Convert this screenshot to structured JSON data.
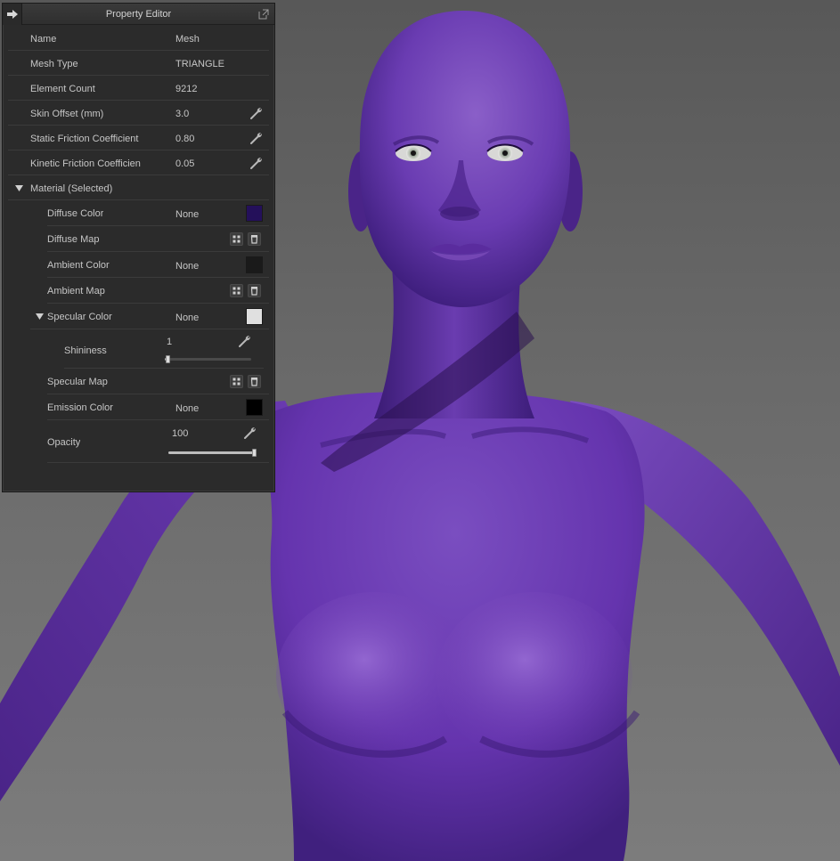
{
  "panel": {
    "title": "Property Editor",
    "rows": [
      {
        "label": "Name",
        "value": "Mesh"
      },
      {
        "label": "Mesh Type",
        "value": "TRIANGLE"
      },
      {
        "label": "Element Count",
        "value": "9212"
      },
      {
        "label": "Skin Offset (mm)",
        "value": "3.0"
      },
      {
        "label": "Static Friction Coefficient",
        "value": "0.80"
      },
      {
        "label": "Kinetic Friction Coefficient",
        "value": "0.05"
      }
    ],
    "material": {
      "header": "Material (Selected)",
      "diffuse_color": {
        "label": "Diffuse Color",
        "value": "None",
        "swatch": "#24105a"
      },
      "diffuse_map": {
        "label": "Diffuse Map"
      },
      "ambient_color": {
        "label": "Ambient Color",
        "value": "None",
        "swatch": "#1a1a1a"
      },
      "ambient_map": {
        "label": "Ambient Map"
      },
      "specular_color": {
        "label": "Specular Color",
        "value": "None",
        "swatch": "#e0e0e0"
      },
      "shininess": {
        "label": "Shininess",
        "value": "1",
        "min": 0,
        "max": 100,
        "level": 1
      },
      "specular_map": {
        "label": "Specular Map"
      },
      "emission_color": {
        "label": "Emission Color",
        "value": "None",
        "swatch": "#000000"
      },
      "opacity": {
        "label": "Opacity",
        "value": "100",
        "min": 0,
        "max": 100,
        "level": 100
      }
    }
  },
  "colors": {
    "accent": "#f0a53a",
    "skin_dark": "#3c1d7a",
    "skin_mid": "#5e33a8",
    "skin_light": "#8a5fc8"
  }
}
